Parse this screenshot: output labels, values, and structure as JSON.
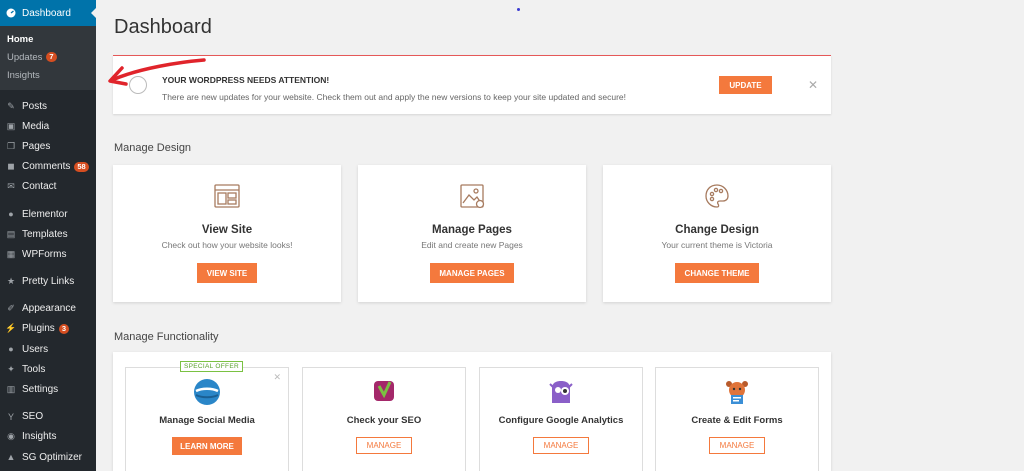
{
  "sidebar": {
    "active": "Dashboard",
    "sub_items": [
      {
        "label": "Home",
        "current": true
      },
      {
        "label": "Updates",
        "badge": "7"
      },
      {
        "label": "Insights"
      }
    ],
    "groups": [
      [
        {
          "label": "Posts",
          "icon": "pin-icon"
        },
        {
          "label": "Media",
          "icon": "media-icon"
        },
        {
          "label": "Pages",
          "icon": "pages-icon"
        },
        {
          "label": "Comments",
          "icon": "comments-icon",
          "badge": "58"
        },
        {
          "label": "Contact",
          "icon": "mail-icon"
        }
      ],
      [
        {
          "label": "Elementor",
          "icon": "elementor-icon"
        },
        {
          "label": "Templates",
          "icon": "folder-icon"
        },
        {
          "label": "WPForms",
          "icon": "forms-icon"
        }
      ],
      [
        {
          "label": "Pretty Links",
          "icon": "star-icon"
        }
      ],
      [
        {
          "label": "Appearance",
          "icon": "brush-icon"
        },
        {
          "label": "Plugins",
          "icon": "plug-icon",
          "badge": "3"
        },
        {
          "label": "Users",
          "icon": "user-icon"
        },
        {
          "label": "Tools",
          "icon": "wrench-icon"
        },
        {
          "label": "Settings",
          "icon": "settings-icon"
        }
      ],
      [
        {
          "label": "SEO",
          "icon": "seo-icon"
        },
        {
          "label": "Insights",
          "icon": "insights-icon"
        },
        {
          "label": "SG Optimizer",
          "icon": "optimizer-icon"
        }
      ]
    ]
  },
  "main": {
    "title": "Dashboard",
    "notice": {
      "title": "YOUR WORDPRESS NEEDS ATTENTION!",
      "text": "There are new updates for your website. Check them out and apply the new versions to keep your site updated and secure!",
      "button": "UPDATE",
      "close": "✕"
    },
    "design": {
      "title": "Manage Design",
      "cards": [
        {
          "title": "View Site",
          "desc": "Check out how your website looks!",
          "button": "VIEW SITE"
        },
        {
          "title": "Manage Pages",
          "desc": "Edit and create new Pages",
          "button": "MANAGE PAGES"
        },
        {
          "title": "Change Design",
          "desc": "Your current theme is Victoria",
          "button": "CHANGE THEME"
        }
      ]
    },
    "functionality": {
      "title": "Manage Functionality",
      "cards": [
        {
          "title": "Manage Social Media",
          "button": "LEARN MORE",
          "tag": "SPECIAL OFFER",
          "close": "✕"
        },
        {
          "title": "Check your SEO",
          "button": "MANAGE"
        },
        {
          "title": "Configure Google Analytics",
          "button": "MANAGE"
        },
        {
          "title": "Create & Edit Forms",
          "button": "MANAGE"
        }
      ]
    }
  },
  "colors": {
    "sidebar_bg": "#23282d",
    "active_blue": "#0073aa",
    "accent_orange": "#f4793d",
    "badge_red": "#d54e21",
    "arrow_red": "#e0242b"
  }
}
